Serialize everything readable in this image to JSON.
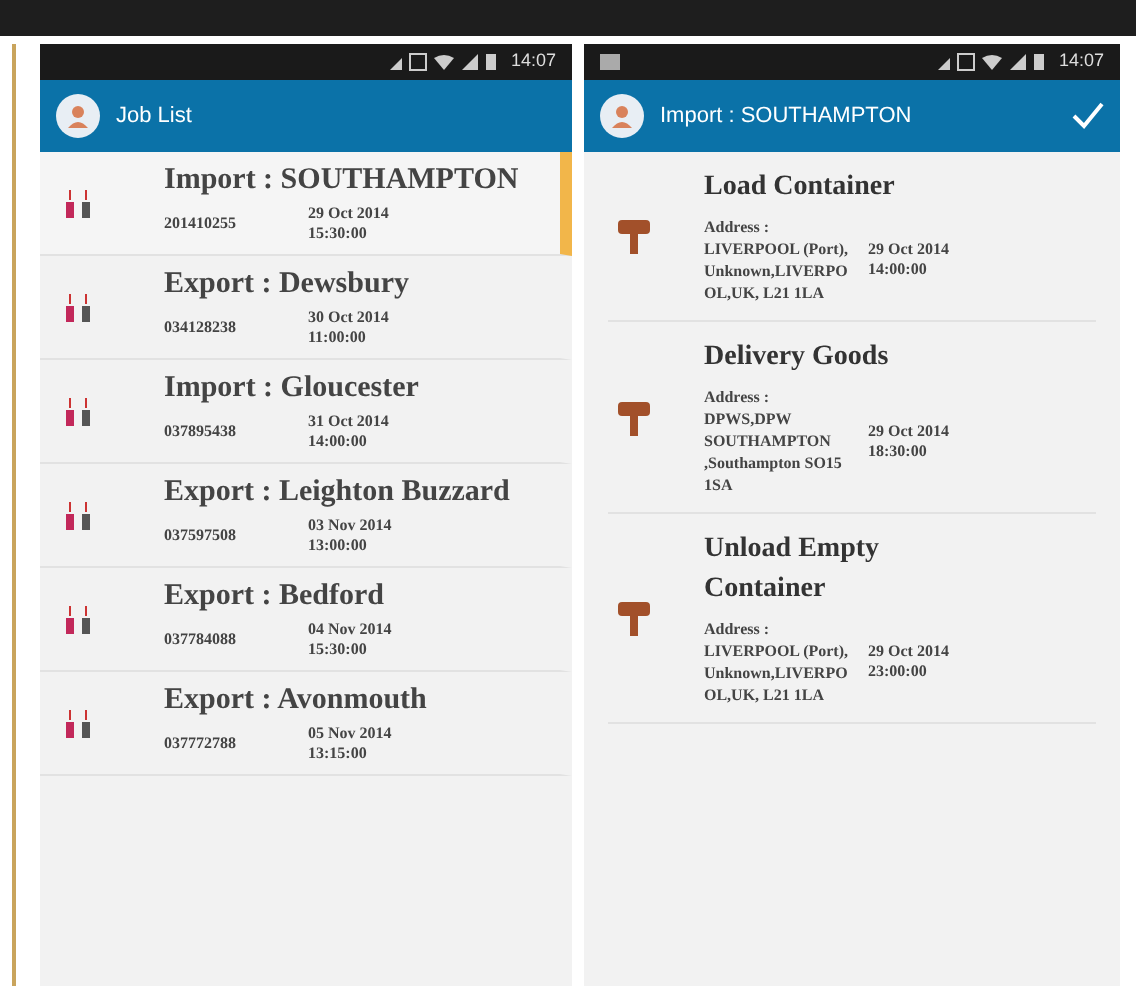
{
  "left_screen": {
    "status_bar": {
      "time": "14:07"
    },
    "app_bar": {
      "title": "Job List"
    },
    "jobs": [
      {
        "title": "Import : SOUTHAMPTON",
        "number": "201410255",
        "date": "29 Oct 2014",
        "time": "15:30:00",
        "selected": true
      },
      {
        "title": "Export : Dewsbury",
        "number": "034128238",
        "date": "30 Oct 2014",
        "time": "11:00:00",
        "selected": false
      },
      {
        "title": "Import : Gloucester",
        "number": "037895438",
        "date": "31 Oct 2014",
        "time": "14:00:00",
        "selected": false
      },
      {
        "title": "Export : Leighton Buzzard",
        "number": "037597508",
        "date": "03 Nov 2014",
        "time": "13:00:00",
        "selected": false
      },
      {
        "title": "Export : Bedford",
        "number": "037784088",
        "date": "04 Nov 2014",
        "time": "15:30:00",
        "selected": false
      },
      {
        "title": "Export : Avonmouth",
        "number": "037772788",
        "date": "05 Nov 2014",
        "time": "13:15:00",
        "selected": false
      }
    ]
  },
  "right_screen": {
    "status_bar": {
      "time": "14:07"
    },
    "app_bar": {
      "title": "Import : SOUTHAMPTON"
    },
    "tasks": [
      {
        "title": "Load Container",
        "address": "Address : LIVERPOOL (Port), Unknown,LIVERPOOL,UK, L21 1LA",
        "date": "29 Oct 2014",
        "time": "14:00:00"
      },
      {
        "title": "Delivery Goods",
        "address": "Address : DPWS,DPW SOUTHAMPTON ,Southampton SO15 1SA",
        "date": "29 Oct 2014",
        "time": "18:30:00"
      },
      {
        "title": "Unload Empty Container",
        "address": "Address : LIVERPOOL (Port), Unknown,LIVERPOOL,UK, L21 1LA",
        "date": "29 Oct 2014",
        "time": "23:00:00"
      }
    ]
  }
}
